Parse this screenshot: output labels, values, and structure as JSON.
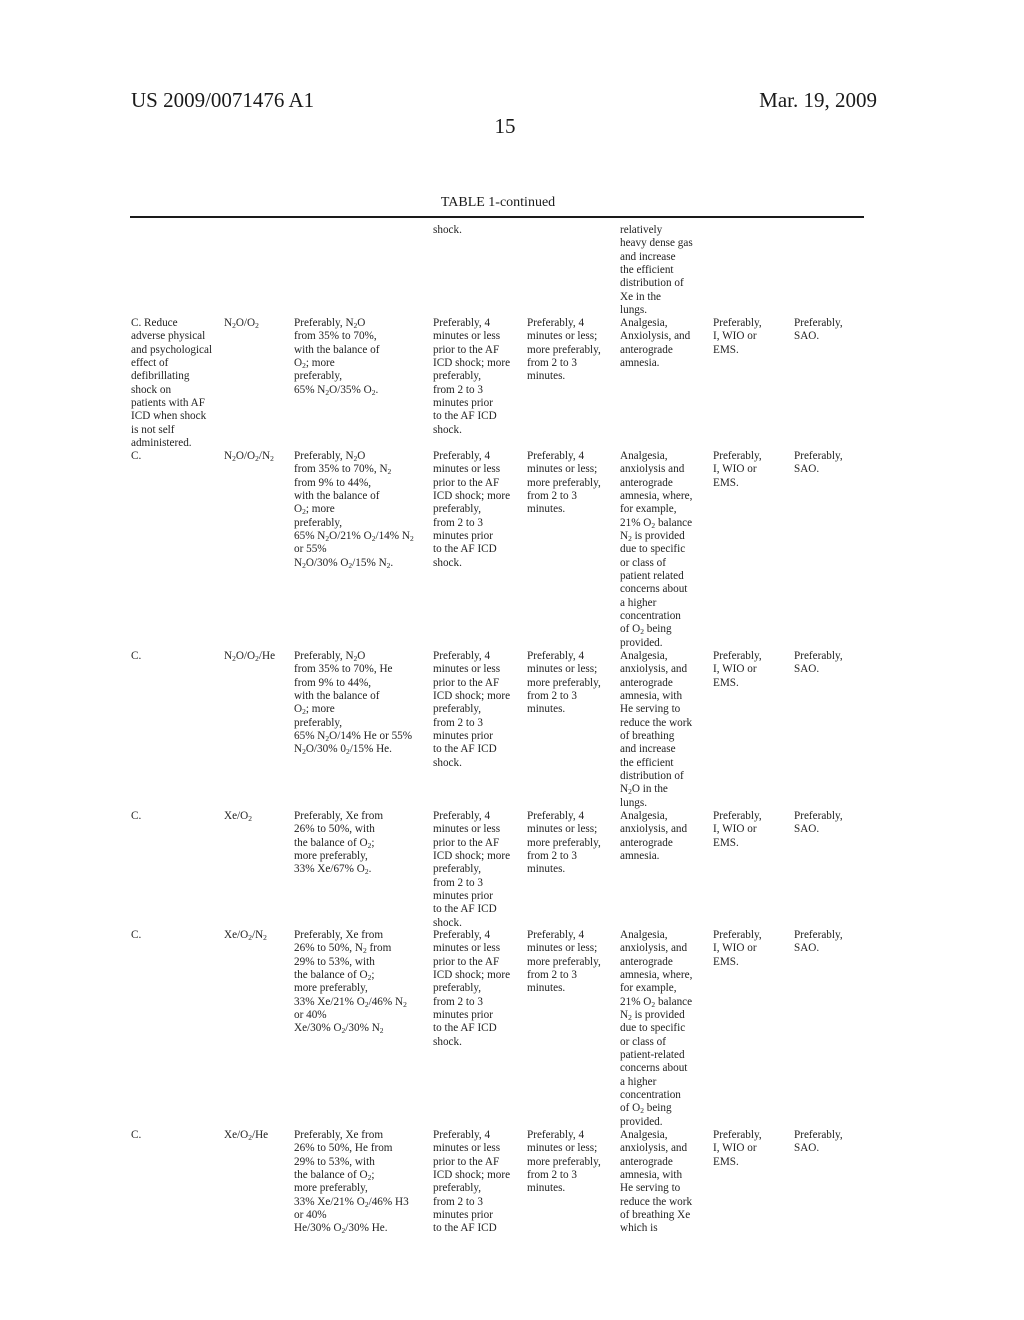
{
  "header": {
    "patent_number": "US 2009/0071476 A1",
    "date": "Mar. 19, 2009",
    "page_number": "15"
  },
  "table": {
    "title": "TABLE 1-continued",
    "continuation": {
      "col4": "shock.",
      "col6": "relatively\nheavy dense gas\nand increase\nthe efficient\ndistribution of\nXe in the\nlungs."
    },
    "rows": [
      {
        "indication": "C. Reduce\nadverse physical\nand psychological\neffect of\ndefibrillating\nshock on\npatients with AF\nICD when shock\nis not self\nadministered.",
        "gas_html": "N<sub>2</sub>O/O<sub>2</sub>",
        "composition_html": "Preferably, N<sub>2</sub>O\nfrom 35% to 70%,\nwith the balance of\nO<sub>2</sub>; more\npreferably,\n65% N<sub>2</sub>O/35% O<sub>2</sub>.",
        "timing": "Preferably, 4\nminutes or less\nprior to the AF\nICD shock; more\npreferably,\nfrom 2 to 3\nminutes prior\nto the AF ICD\nshock.",
        "duration": "Preferably, 4\nminutes or less;\nmore preferably,\nfrom 2 to 3\nminutes.",
        "effect_html": "Analgesia,\nAnxiolysis, and\nanterograde\namnesia.",
        "setting": "Preferably,\nI, WIO or\nEMS.",
        "administration": "Preferably,\nSAO."
      },
      {
        "indication": "C.",
        "gas_html": "N<sub>2</sub>O/O<sub>2</sub>/N<sub>2</sub>",
        "composition_html": "Preferably, N<sub>2</sub>O\nfrom 35% to 70%, N<sub>2</sub>\nfrom 9% to 44%,\nwith the balance of\nO<sub>2</sub>; more\npreferably,\n65% N<sub>2</sub>O/21% O<sub>2</sub>/14% N<sub>2</sub>\nor 55%\nN<sub>2</sub>O/30% O<sub>2</sub>/15% N<sub>2</sub>.",
        "timing": "Preferably, 4\nminutes or less\nprior to the AF\nICD shock; more\npreferably,\nfrom 2 to 3\nminutes prior\nto the AF ICD\nshock.",
        "duration": "Preferably, 4\nminutes or less;\nmore preferably,\nfrom 2 to 3\nminutes.",
        "effect_html": "Analgesia,\nanxiolysis and\nanterograde\namnesia, where,\nfor example,\n21% O<sub>2</sub> balance\nN<sub>2</sub> is provided\ndue to specific\nor class of\npatient related\nconcerns about\na higher\nconcentration\nof O<sub>2</sub> being\nprovided.",
        "setting": "Preferably,\nI, WIO or\nEMS.",
        "administration": "Preferably,\nSAO."
      },
      {
        "indication": "C.",
        "gas_html": "N<sub>2</sub>O/O<sub>2</sub>/He",
        "composition_html": "Preferably, N<sub>2</sub>O\nfrom 35% to 70%, He\nfrom 9% to 44%,\nwith the balance of\nO<sub>2</sub>; more\npreferably,\n65% N<sub>2</sub>O/14% He or 55%\nN<sub>2</sub>O/30% 0<sub>2</sub>/15% He.",
        "timing": "Preferably, 4\nminutes or less\nprior to the AF\nICD shock; more\npreferably,\nfrom 2 to 3\nminutes prior\nto the AF ICD\nshock.",
        "duration": "Preferably, 4\nminutes or less;\nmore preferably,\nfrom 2 to 3\nminutes.",
        "effect_html": "Analgesia,\nanxiolysis, and\nanterograde\namnesia, with\nHe serving to\nreduce the work\nof breathing\nand increase\nthe efficient\ndistribution of\nN<sub>2</sub>O in the\nlungs.",
        "setting": "Preferably,\nI, WIO or\nEMS.",
        "administration": "Preferably,\nSAO."
      },
      {
        "indication": "C.",
        "gas_html": "Xe/O<sub>2</sub>",
        "composition_html": "Preferably, Xe from\n26% to 50%, with\nthe balance of O<sub>2</sub>;\nmore preferably,\n33% Xe/67% O<sub>2</sub>.",
        "timing": "Preferably, 4\nminutes or less\nprior to the AF\nICD shock; more\npreferably,\nfrom 2 to 3\nminutes prior\nto the AF ICD\nshock.",
        "duration": "Preferably, 4\nminutes or less;\nmore preferably,\nfrom 2 to 3\nminutes.",
        "effect_html": "Analgesia,\nanxiolysis, and\nanterograde\namnesia.",
        "setting": "Preferably,\nI, WIO or\nEMS.",
        "administration": "Preferably,\nSAO."
      },
      {
        "indication": "C.",
        "gas_html": "Xe/O<sub>2</sub>/N<sub>2</sub>",
        "composition_html": "Preferably, Xe from\n26% to 50%, N<sub>2</sub> from\n29% to 53%, with\nthe balance of O<sub>2</sub>;\nmore preferably,\n33% Xe/21% O<sub>2</sub>/46% N<sub>2</sub>\nor 40%\nXe/30% O<sub>2</sub>/30% N<sub>2</sub>",
        "timing": "Preferably, 4\nminutes or less\nprior to the AF\nICD shock; more\npreferably,\nfrom 2 to 3\nminutes prior\nto the AF ICD\nshock.",
        "duration": "Preferably, 4\nminutes or less;\nmore preferably,\nfrom 2 to 3\nminutes.",
        "effect_html": "Analgesia,\nanxiolysis, and\nanterograde\namnesia, where,\nfor example,\n21% O<sub>2</sub> balance\nN<sub>2</sub> is provided\ndue to specific\nor class of\npatient-related\nconcerns about\na higher\nconcentration\nof O<sub>2</sub> being\nprovided.",
        "setting": "Preferably,\nI, WIO or\nEMS.",
        "administration": "Preferably,\nSAO."
      },
      {
        "indication": "C.",
        "gas_html": "Xe/O<sub>2</sub>/He",
        "composition_html": "Preferably, Xe from\n26% to 50%, He from\n29% to 53%, with\nthe balance of O<sub>2</sub>;\nmore preferably,\n33% Xe/21% O<sub>2</sub>/46% H3\nor 40%\nHe/30% O<sub>2</sub>/30% He.",
        "timing": "Preferably, 4\nminutes or less\nprior to the AF\nICD shock; more\npreferably,\nfrom 2 to 3\nminutes prior\nto the AF ICD",
        "duration": "Preferably, 4\nminutes or less;\nmore preferably,\nfrom 2 to 3\nminutes.",
        "effect_html": "Analgesia,\nanxiolysis, and\nanterograde\namnesia, with\nHe serving to\nreduce the work\nof breathing Xe\nwhich is",
        "setting": "Preferably,\nI, WIO or\nEMS.",
        "administration": "Preferably,\nSAO."
      }
    ]
  }
}
